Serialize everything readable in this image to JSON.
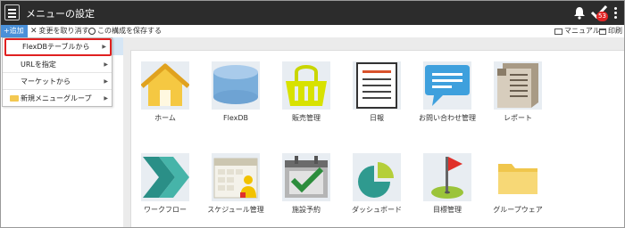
{
  "window": {
    "title": "メニューの設定",
    "notification_count": "53"
  },
  "toolbar": {
    "add_label": "+追加",
    "undo_label": "変更を取り消す",
    "save_label": "この構成を保存する",
    "manual_label": "マニュアル",
    "print_label": "印刷"
  },
  "dropdown": {
    "items": [
      {
        "label": "FlexDBテーブルから",
        "has_submenu": true,
        "highlighted": true
      },
      {
        "label": "URLを指定",
        "has_submenu": true
      },
      {
        "label": "マーケットから",
        "has_submenu": true
      },
      {
        "label": "新規メニューグループ",
        "has_submenu": true,
        "icon": "folder-icon"
      }
    ]
  },
  "tiles": [
    {
      "label": "ホーム",
      "icon": "home-icon"
    },
    {
      "label": "FlexDB",
      "icon": "database-icon"
    },
    {
      "label": "販売管理",
      "icon": "shopping-basket-icon"
    },
    {
      "label": "日報",
      "icon": "document-icon"
    },
    {
      "label": "お問い合わせ管理",
      "icon": "chat-bubble-icon"
    },
    {
      "label": "レポート",
      "icon": "report-icon"
    },
    {
      "label": "ワークフロー",
      "icon": "workflow-arrows-icon"
    },
    {
      "label": "スケジュール管理",
      "icon": "schedule-icon"
    },
    {
      "label": "施設予約",
      "icon": "facility-booking-icon"
    },
    {
      "label": "ダッシュボード",
      "icon": "dashboard-pie-icon"
    },
    {
      "label": "目標管理",
      "icon": "goal-flag-icon"
    },
    {
      "label": "グループウェア",
      "icon": "folder-icon"
    }
  ],
  "colors": {
    "titlebar": "#2c2c2c",
    "accent": "#4a90d9",
    "highlight_border": "#e02020",
    "badge": "#e02424"
  }
}
